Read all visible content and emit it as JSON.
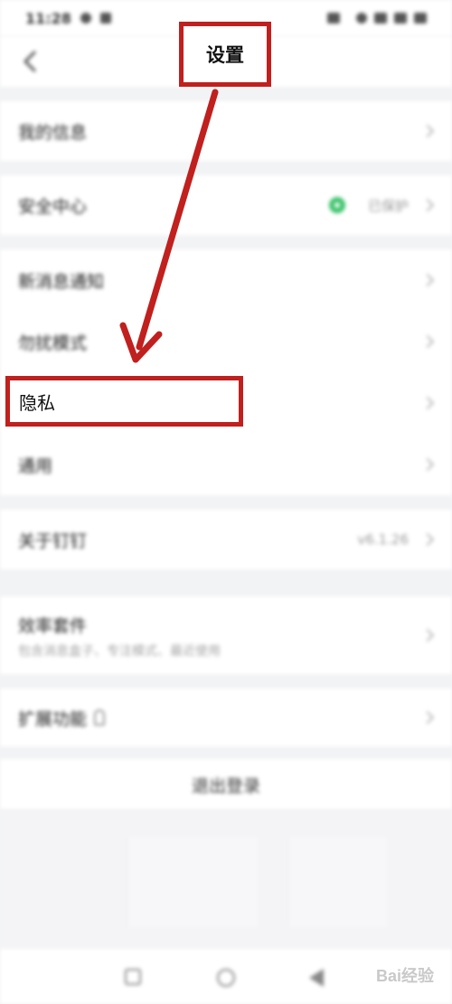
{
  "status_bar": {
    "time": "11:28"
  },
  "nav": {
    "title": "设置"
  },
  "groups": [
    {
      "items": [
        {
          "label": "我的信息"
        }
      ]
    },
    {
      "items": [
        {
          "label": "安全中心",
          "value": "已保护"
        }
      ]
    },
    {
      "items": [
        {
          "label": "新消息通知"
        },
        {
          "label": "勿扰模式"
        },
        {
          "label": "隐私"
        },
        {
          "label": "通用"
        }
      ]
    },
    {
      "items": [
        {
          "label": "关于钉钉",
          "value": "v6.1.26"
        }
      ]
    },
    {
      "items": [
        {
          "label": "效率套件",
          "subtitle": "包含消息盒子、专注模式、最近使用"
        }
      ]
    },
    {
      "items": [
        {
          "label": "扩展功能"
        }
      ]
    }
  ],
  "logout": {
    "label": "退出登录"
  },
  "watermark": "Bai经验",
  "colors": {
    "highlight": "#c0201e",
    "shield": "#3cc36b"
  }
}
